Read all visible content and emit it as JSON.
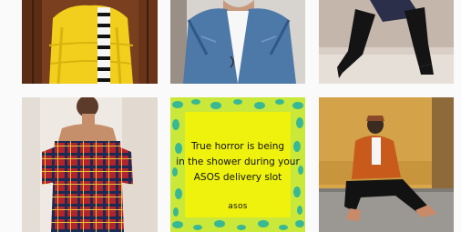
{
  "feed": {
    "posts": [
      {
        "kind": "photo",
        "subject": "yellow-puffer-jacket"
      },
      {
        "kind": "photo",
        "subject": "denim-jacket"
      },
      {
        "kind": "photo",
        "subject": "black-boots"
      },
      {
        "kind": "photo",
        "subject": "tartan-dress"
      },
      {
        "kind": "graphic",
        "quote_lines": [
          "True horror is being",
          "in the shower during your",
          "ASOS delivery slot"
        ],
        "brand": "asos",
        "background_color": "#eef20c",
        "border_color": "#38b894"
      },
      {
        "kind": "photo",
        "subject": "orange-jacket-on-street"
      }
    ]
  }
}
